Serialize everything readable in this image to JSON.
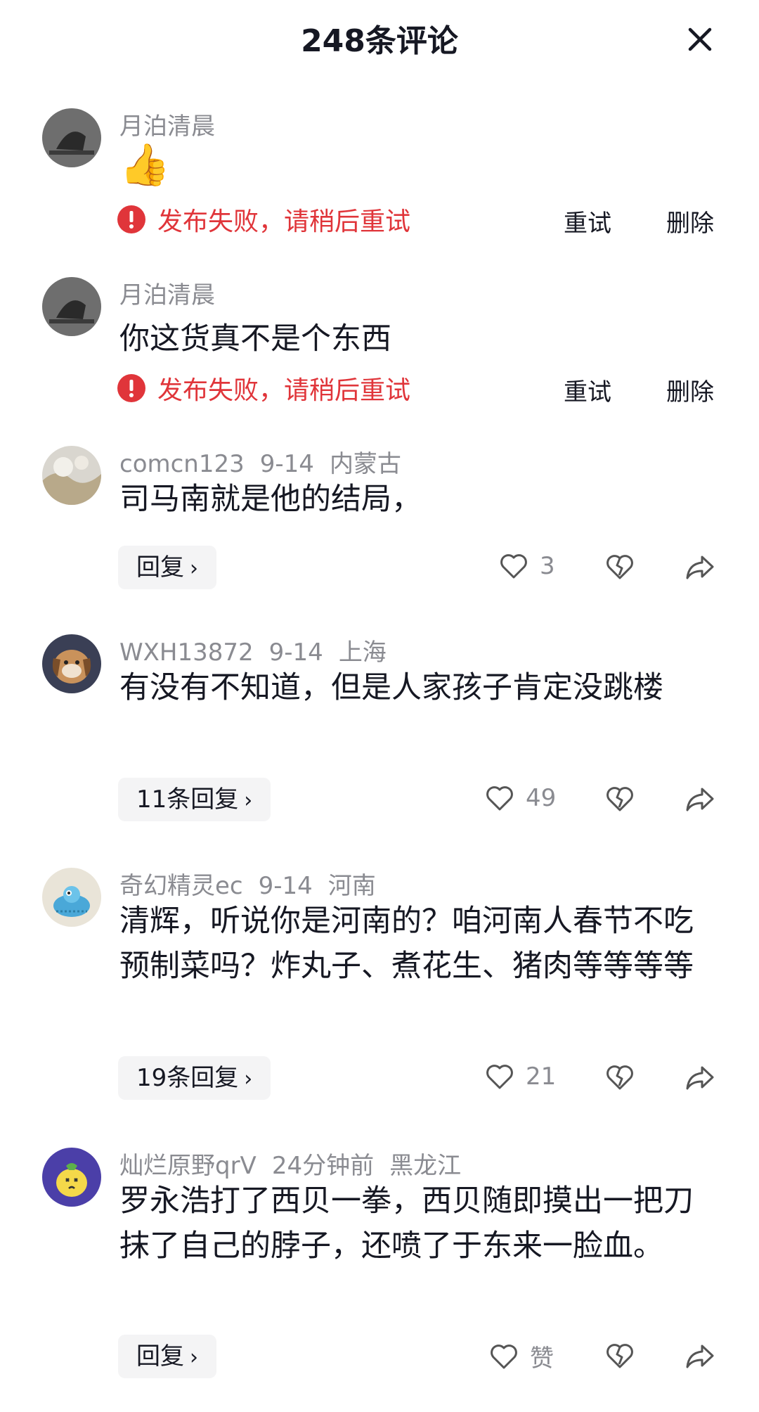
{
  "header": {
    "title": "248条评论"
  },
  "failed_comments": [
    {
      "user": "月泊清晨",
      "content": "👍",
      "error": "发布失败，请稍后重试",
      "retry": "重试",
      "delete": "删除"
    },
    {
      "user": "月泊清晨",
      "content": "你这货真不是个东西",
      "error": "发布失败，请稍后重试",
      "retry": "重试",
      "delete": "删除"
    }
  ],
  "comments": [
    {
      "user": "comcn123",
      "date": "9-14",
      "location": "内蒙古",
      "content": "司马南就是他的结局，",
      "reply_label": "回复",
      "likes": "3"
    },
    {
      "user": "WXH13872",
      "date": "9-14",
      "location": "上海",
      "content": "有没有不知道，但是人家孩子肯定没跳楼",
      "reply_label": "11条回复",
      "likes": "49"
    },
    {
      "user": "奇幻精灵ec",
      "date": "9-14",
      "location": "河南",
      "content": "清辉，听说你是河南的？咱河南人春节不吃预制菜吗？炸丸子、煮花生、猪肉等等等等",
      "reply_label": "19条回复",
      "likes": "21"
    },
    {
      "user": "灿烂原野qrV",
      "date": "24分钟前",
      "location": "黑龙江",
      "content": "罗永浩打了西贝一拳，西贝随即摸出一把刀抹了自己的脖子，还喷了于东来一脸血。",
      "reply_label": "回复",
      "likes": "赞"
    }
  ],
  "icons": {
    "close": "close-icon",
    "error": "error-icon",
    "like": "heart-icon",
    "dislike": "broken-heart-icon",
    "share": "share-icon"
  },
  "colors": {
    "error": "#e0353a",
    "meta": "#8a8b91",
    "text": "#161823"
  }
}
